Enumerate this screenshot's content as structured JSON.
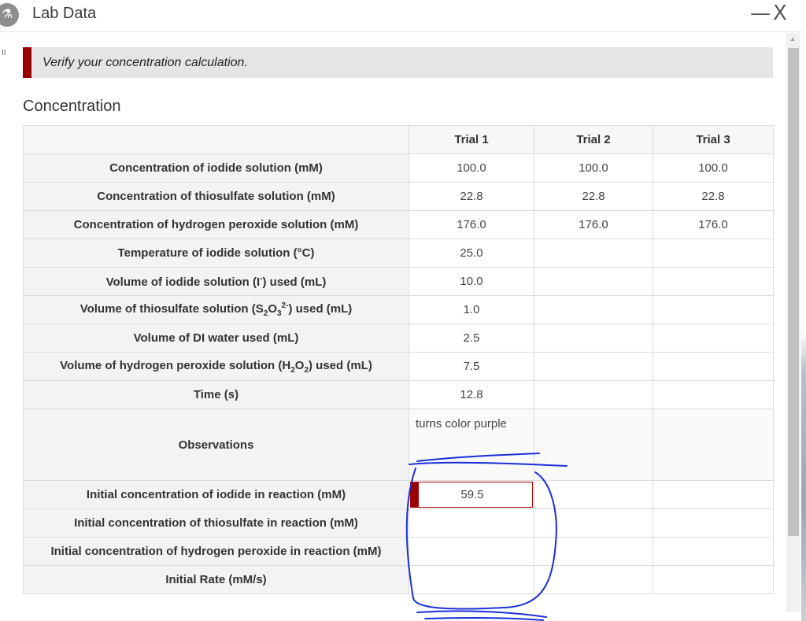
{
  "window": {
    "title": "Lab Data",
    "icon_glyph": "⚗",
    "minimize_glyph": "—",
    "close_glyph": "X"
  },
  "side_mark": "II",
  "alert": {
    "text": "Verify your concentration calculation.",
    "color": "#990000"
  },
  "section": {
    "title": "Concentration"
  },
  "table": {
    "columns": [
      "Trial 1",
      "Trial 2",
      "Trial 3"
    ],
    "rows": {
      "iodide_conc": {
        "label": "Concentration of iodide solution (mM)",
        "values": [
          "100.0",
          "100.0",
          "100.0"
        ]
      },
      "thio_conc": {
        "label": "Concentration of thiosulfate solution (mM)",
        "values": [
          "22.8",
          "22.8",
          "22.8"
        ]
      },
      "h2o2_conc": {
        "label": "Concentration of hydrogen peroxide solution (mM)",
        "values": [
          "176.0",
          "176.0",
          "176.0"
        ]
      },
      "temp": {
        "label": "Temperature of iodide solution (°C)",
        "values": [
          "25.0",
          "",
          ""
        ]
      },
      "vol_iodide": {
        "label_pre": "Volume of iodide solution (I",
        "label_sup": "-",
        "label_post": ") used (mL)",
        "values": [
          "10.0",
          "",
          ""
        ]
      },
      "vol_thio": {
        "label_pre": "Volume of thiosulfate solution (S",
        "sub1": "2",
        "mid1": "O",
        "sub2": "3",
        "sup": "2-",
        "label_post": ") used (mL)",
        "values": [
          "1.0",
          "",
          ""
        ]
      },
      "vol_di": {
        "label": "Volume of DI water used (mL)",
        "values": [
          "2.5",
          "",
          ""
        ]
      },
      "vol_h2o2": {
        "label_pre": "Volume of hydrogen peroxide solution (H",
        "sub1": "2",
        "mid1": "O",
        "sub2": "2",
        "label_post": ") used (mL)",
        "values": [
          "7.5",
          "",
          ""
        ]
      },
      "time": {
        "label": "Time (s)",
        "values": [
          "12.8",
          "",
          ""
        ]
      },
      "observations": {
        "label": "Observations",
        "values": [
          "turns color purple",
          "",
          ""
        ]
      },
      "init_iodide": {
        "label": "Initial concentration of iodide in reaction (mM)",
        "values": [
          "59.5",
          "",
          ""
        ]
      },
      "init_thio": {
        "label": "Initial concentration of thiosulfate in reaction (mM)",
        "values": [
          "",
          "",
          ""
        ]
      },
      "init_h2o2": {
        "label": "Initial concentration of hydrogen peroxide in reaction (mM)",
        "values": [
          "",
          "",
          ""
        ]
      },
      "init_rate": {
        "label": "Initial Rate (mM/s)",
        "values": [
          "",
          "",
          ""
        ]
      }
    }
  },
  "annotation_color": "#1a2fd6"
}
